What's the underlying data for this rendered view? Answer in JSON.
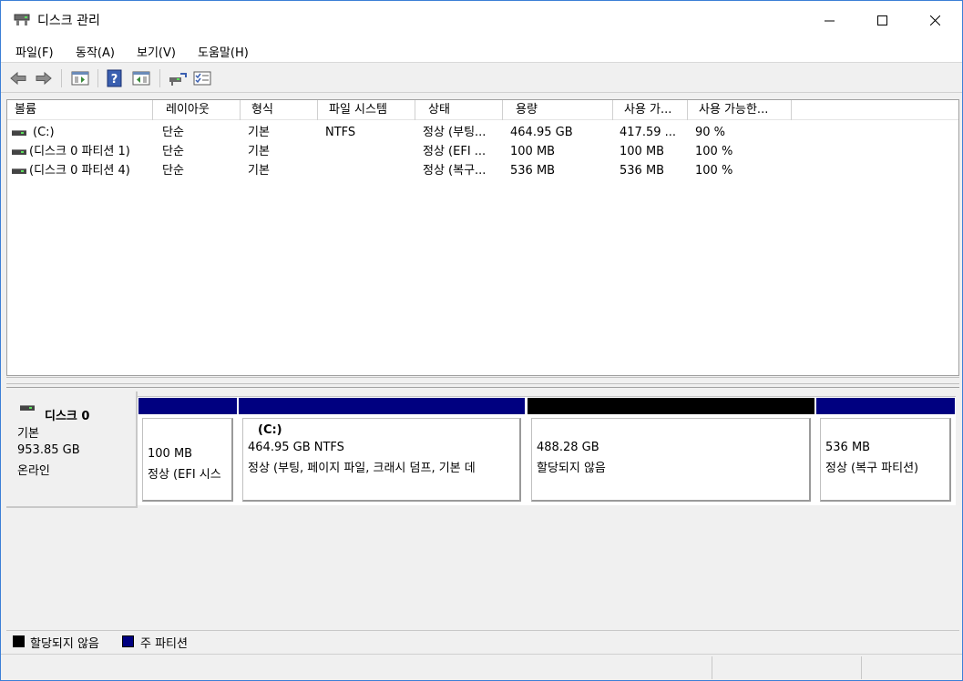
{
  "window": {
    "title": "디스크 관리"
  },
  "menu": [
    {
      "label": "파일(F)"
    },
    {
      "label": "동작(A)"
    },
    {
      "label": "보기(V)"
    },
    {
      "label": "도움말(H)"
    }
  ],
  "toolbar": [
    "back-arrow-icon",
    "forward-arrow-icon",
    "console-tree-icon",
    "help-icon",
    "action-pane-icon",
    "connect-icon",
    "properties-icon"
  ],
  "volumes": {
    "columns": [
      "볼륨",
      "레이아웃",
      "형식",
      "파일 시스템",
      "상태",
      "용량",
      "사용 가...",
      "사용 가능한..."
    ],
    "rows": [
      {
        "volume": "(C:)",
        "layout": "단순",
        "type": "기본",
        "fs": "NTFS",
        "status": "정상 (부팅...",
        "capacity": "464.95 GB",
        "free": "417.59 ...",
        "pct": "90 %"
      },
      {
        "volume": "(디스크 0 파티션 1)",
        "layout": "단순",
        "type": "기본",
        "fs": "",
        "status": "정상 (EFI ...",
        "capacity": "100 MB",
        "free": "100 MB",
        "pct": "100 %"
      },
      {
        "volume": "(디스크 0 파티션 4)",
        "layout": "단순",
        "type": "기본",
        "fs": "",
        "status": "정상 (복구...",
        "capacity": "536 MB",
        "free": "536 MB",
        "pct": "100 %"
      }
    ]
  },
  "disk": {
    "name": "디스크 0",
    "kind": "기본",
    "size": "953.85 GB",
    "state": "온라인",
    "partitions": [
      {
        "title": "",
        "size": "100 MB",
        "status": "정상 (EFI 시스",
        "kind": "primary"
      },
      {
        "title": "(C:)",
        "size": "464.95 GB NTFS",
        "status": "정상 (부팅, 페이지 파일, 크래시 덤프, 기본 데",
        "kind": "primary"
      },
      {
        "title": "",
        "size": "488.28 GB",
        "status": "할당되지 않음",
        "kind": "unallocated"
      },
      {
        "title": "",
        "size": "536 MB",
        "status": "정상 (복구 파티션)",
        "kind": "primary"
      }
    ]
  },
  "legend": {
    "unallocated": "할당되지 않음",
    "primary": "주 파티션"
  },
  "colors": {
    "primary": "#000080",
    "unallocated": "#000000",
    "window_border": "#3c7fd6"
  }
}
